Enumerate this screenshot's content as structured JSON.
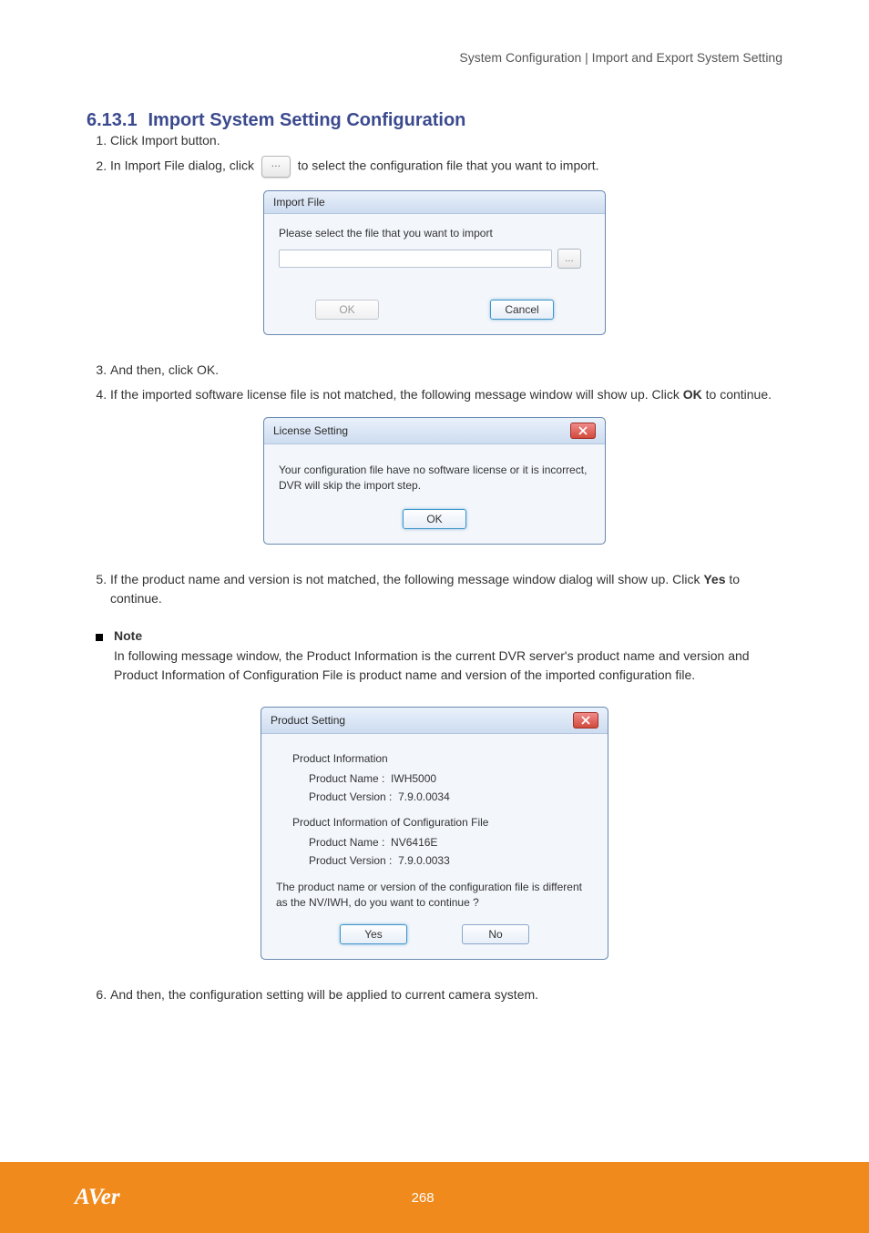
{
  "header": {
    "breadcrumb": "System Configuration | Import and Export System Setting"
  },
  "section_number": "6.13.1",
  "section_title": "Import System Setting Configuration",
  "steps": [
    "Click Import button.",
    "In Import File dialog, click"
  ],
  "after_step2": "to select the configuration file that you want to import.",
  "dlg_import": {
    "title": "Import File",
    "prompt": "Please select the file that you want to import",
    "ok": "OK",
    "cancel": "Cancel"
  },
  "step3": "And then, click OK.",
  "step4_prefix": "If the imported software license file is not matched, the following message window will show up. Click ",
  "step4_ok": "OK",
  "step4_suffix": " to continue.",
  "dlg_license": {
    "title": "License Setting",
    "message": "Your configuration file have no software license or it is incorrect, DVR will skip the import step.",
    "ok": "OK"
  },
  "step5_prefix": "If the product name and version is not matched, the following message window dialog will show up. Click ",
  "step5_yes": "Yes",
  "step5_suffix": " to continue.",
  "note_title": "Note",
  "note_body": "In following message window, the Product Information is the current DVR server's product name and version and Product Information of Configuration File is product name and version of the imported configuration file.",
  "dlg_product": {
    "title": "Product Setting",
    "section1": "Product Information",
    "s1_name_label": "Product Name    :",
    "s1_name_value": "IWH5000",
    "s1_ver_label": "Product Version  :",
    "s1_ver_value": "7.9.0.0034",
    "section2": "Product Information of Configuration File",
    "s2_name_label": "Product Name    :",
    "s2_name_value": "NV6416E",
    "s2_ver_label": "Product Version  :",
    "s2_ver_value": "7.9.0.0033",
    "warn": "The product name or version of the configuration file is different as the NV/IWH, do you want to continue ?",
    "yes": "Yes",
    "no": "No"
  },
  "step6": "And then, the configuration setting will be applied to current camera system.",
  "footer": {
    "brand": "AVer",
    "page": "268"
  }
}
